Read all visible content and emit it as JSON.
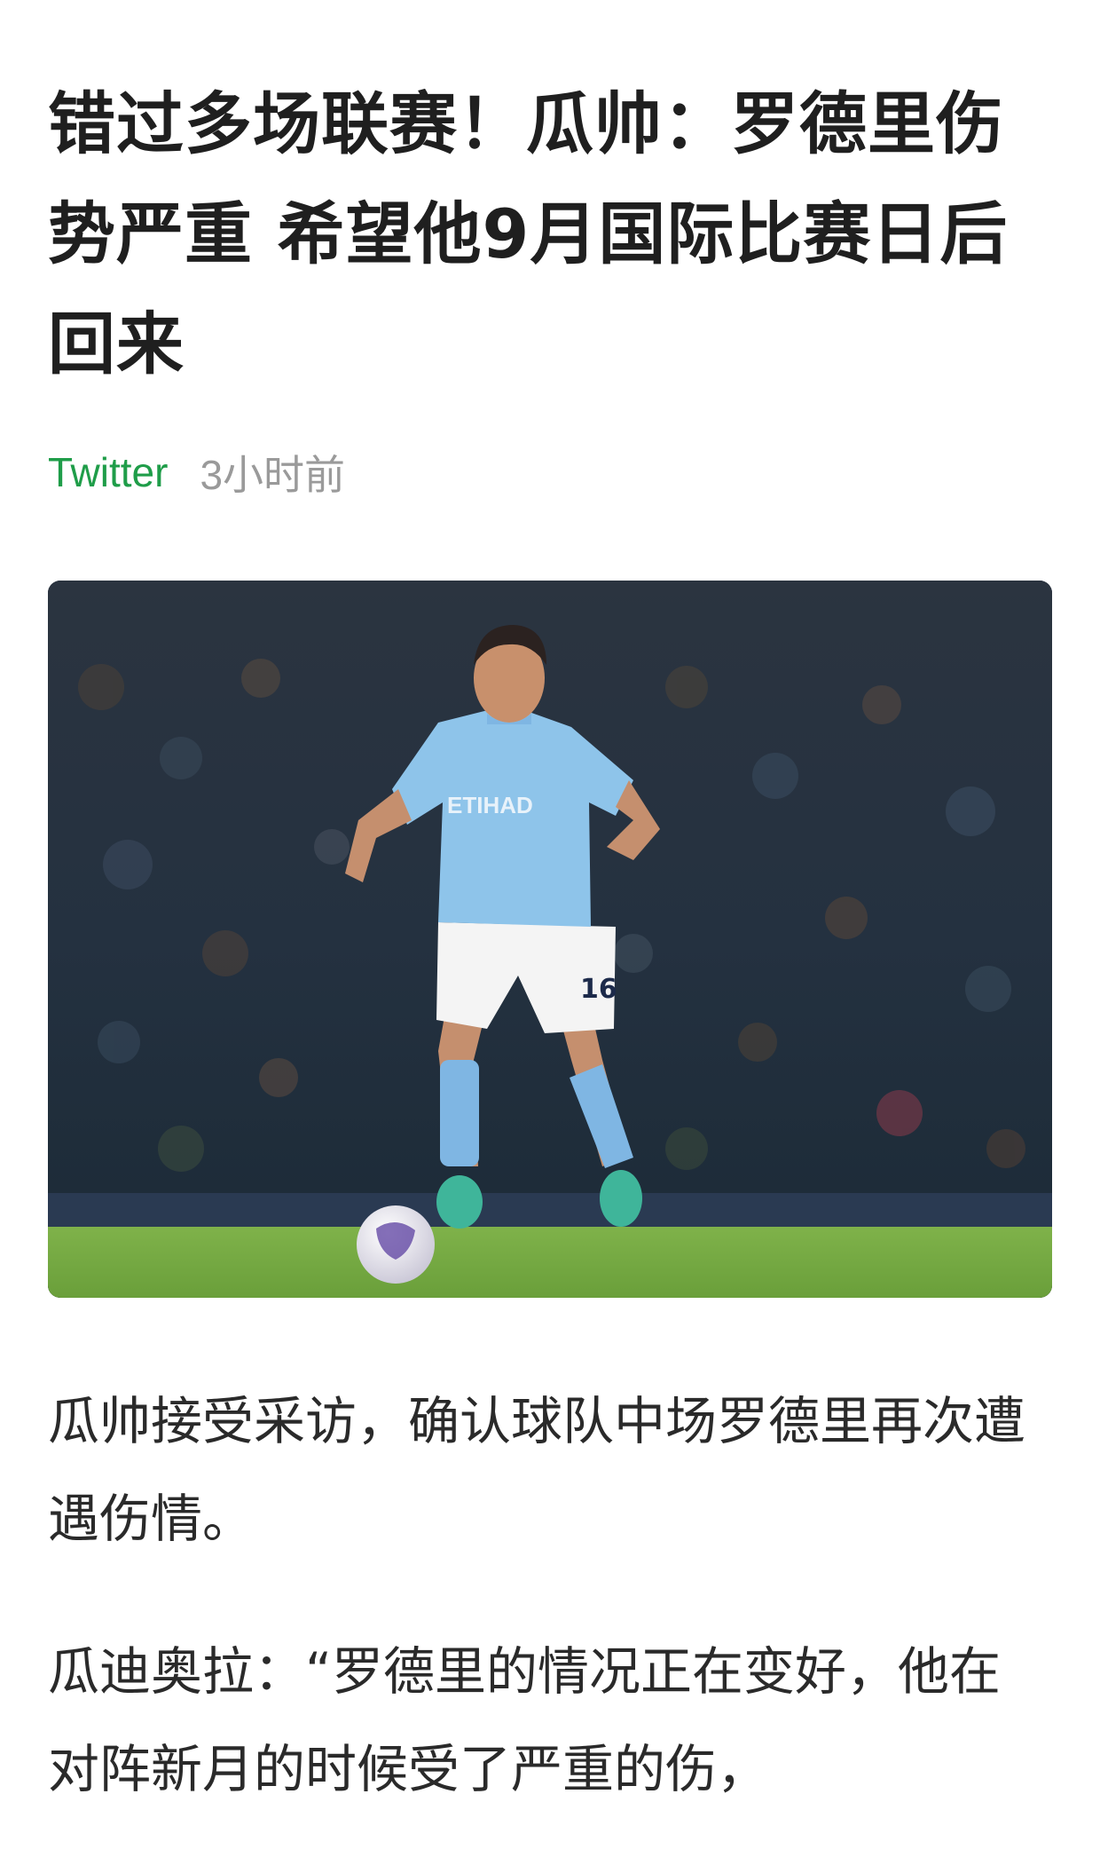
{
  "article": {
    "title": "错过多场联赛！瓜帅：罗德里伤势严重 希望他9月国际比赛日后回来",
    "source": "Twitter",
    "time": "3小时前"
  },
  "image": {
    "jersey_sponsor": "ETIHAD",
    "jersey_number": "16"
  },
  "paragraphs": [
    "瓜帅接受采访，确认球队中场罗德里再次遭遇伤情。",
    "瓜迪奥拉：“罗德里的情况正在变好，他在对阵新月的时候受了严重的伤，"
  ],
  "colors": {
    "source": "#1f9d49",
    "time": "#9a9a9a",
    "title": "#1f1f1f"
  }
}
